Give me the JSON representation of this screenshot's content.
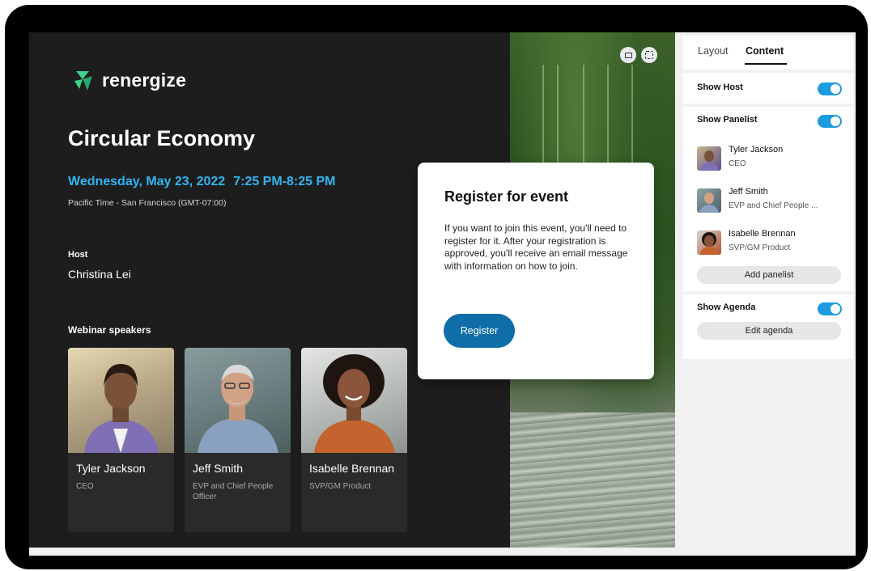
{
  "brand": {
    "name": "renergize"
  },
  "event": {
    "title": "Circular Economy",
    "date": "Wednesday, May 23, 2022",
    "time": "7:25 PM-8:25 PM",
    "timezone": "Pacific Time - San Francisco (GMT-07:00)",
    "host_label": "Host",
    "host_name": "Christina Lei",
    "speakers_label": "Webinar speakers",
    "speakers": [
      {
        "name": "Tyler Jackson",
        "role": "CEO"
      },
      {
        "name": "Jeff Smith",
        "role": "EVP and Chief People Officer"
      },
      {
        "name": "Isabelle Brennan",
        "role": "SVP/GM Product"
      }
    ]
  },
  "dialog": {
    "title": "Register for event",
    "body": "If you want to join this event, you'll need to register for it. After your registration is approved, you'll receive an email message with information on how to join.",
    "button": "Register"
  },
  "panel": {
    "tabs": [
      "Layout",
      "Content"
    ],
    "active_tab": "Content",
    "show_host": {
      "label": "Show Host",
      "enabled": true
    },
    "show_panelist": {
      "label": "Show Panelist",
      "enabled": true
    },
    "panelists": [
      {
        "name": "Tyler Jackson",
        "role": "CEO"
      },
      {
        "name": "Jeff Smith",
        "role": "EVP and Chief People ..."
      },
      {
        "name": "Isabelle Brennan",
        "role": "SVP/GM Product"
      }
    ],
    "add_panelist": "Add panelist",
    "show_agenda": {
      "label": "Show Agenda",
      "enabled": true
    },
    "edit_agenda": "Edit agenda"
  },
  "colors": {
    "accent_blue": "#2fb6f2",
    "toggle_on": "#1d9be0",
    "register_button": "#0f6ea8",
    "brand_green": "#3fd08a"
  }
}
